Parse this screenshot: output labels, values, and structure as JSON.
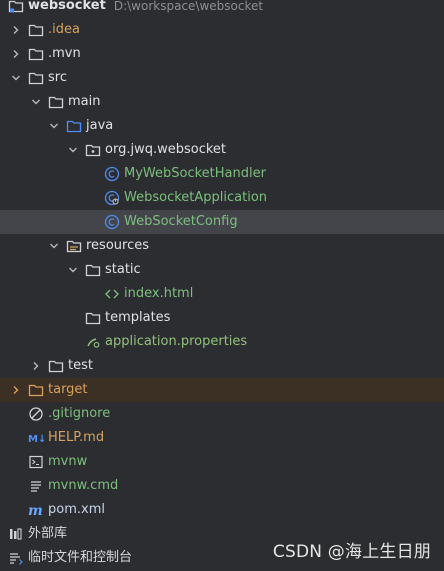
{
  "project": {
    "name": "websocket",
    "path": "D:\\workspace\\websocket"
  },
  "tree": {
    "idea": ".idea",
    "mvn": ".mvn",
    "src": "src",
    "main": "main",
    "java": "java",
    "package": "org.jwq.websocket",
    "class1": "MyWebSocketHandler",
    "class2": "WebsocketApplication",
    "class3": "WebSocketConfig",
    "resources": "resources",
    "static": "static",
    "index": "index.html",
    "templates": "templates",
    "appProps": "application.properties",
    "test": "test",
    "target": "target",
    "gitignore": ".gitignore",
    "help": "HELP.md",
    "mvnw": "mvnw",
    "mvnwcmd": "mvnw.cmd",
    "pom": "pom.xml",
    "external": "外部库",
    "scratch": "临时文件和控制台"
  },
  "watermark": "CSDN @海上生日朋",
  "colors": {
    "background": "#2b2d30",
    "selected": "#43454a",
    "targetHighlight": "#3c2f24",
    "folder": "#c9ccd1",
    "javaBlue": "#4f8df7",
    "orange": "#d8a25f",
    "green": "#7dbf7d"
  }
}
